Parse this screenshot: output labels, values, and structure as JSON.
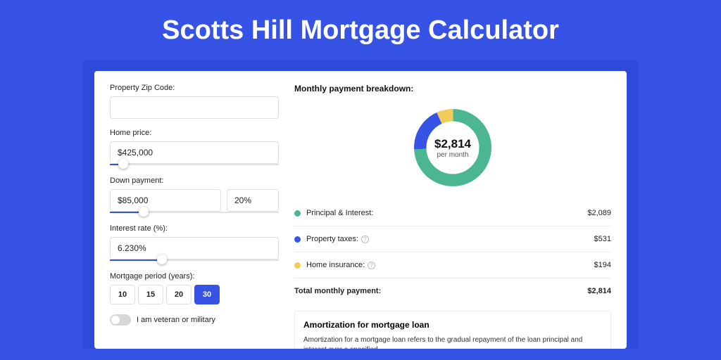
{
  "page": {
    "title": "Scotts Hill Mortgage Calculator"
  },
  "form": {
    "zip": {
      "label": "Property Zip Code:",
      "value": ""
    },
    "price": {
      "label": "Home price:",
      "value": "$425,000",
      "slider_pct": 8
    },
    "down": {
      "label": "Down payment:",
      "amount": "$85,000",
      "pct": "20%",
      "slider_pct": 20
    },
    "rate": {
      "label": "Interest rate (%):",
      "value": "6.230%",
      "slider_pct": 31
    },
    "period": {
      "label": "Mortgage period (years):",
      "options": [
        "10",
        "15",
        "20",
        "30"
      ],
      "selected": "30"
    },
    "veteran": {
      "label": "I am veteran or military",
      "on": false
    }
  },
  "breakdown": {
    "title": "Monthly payment breakdown:",
    "center_amount": "$2,814",
    "center_sub": "per month",
    "items": [
      {
        "label": "Principal & Interest:",
        "value": "$2,089",
        "color": "#4cb592",
        "pct": 74.2,
        "help": false
      },
      {
        "label": "Property taxes:",
        "value": "$531",
        "color": "#3653e5",
        "pct": 18.9,
        "help": true
      },
      {
        "label": "Home insurance:",
        "value": "$194",
        "color": "#f1cb5b",
        "pct": 6.9,
        "help": true
      }
    ],
    "total_label": "Total monthly payment:",
    "total_value": "$2,814"
  },
  "amort": {
    "title": "Amortization for mortgage loan",
    "text": "Amortization for a mortgage loan refers to the gradual repayment of the loan principal and interest over a specified"
  },
  "chart_data": {
    "type": "pie",
    "title": "Monthly payment breakdown",
    "categories": [
      "Principal & Interest",
      "Property taxes",
      "Home insurance"
    ],
    "values": [
      2089,
      531,
      194
    ],
    "colors": [
      "#4cb592",
      "#3653e5",
      "#f1cb5b"
    ],
    "total": 2814,
    "center_label": "$2,814 per month"
  }
}
